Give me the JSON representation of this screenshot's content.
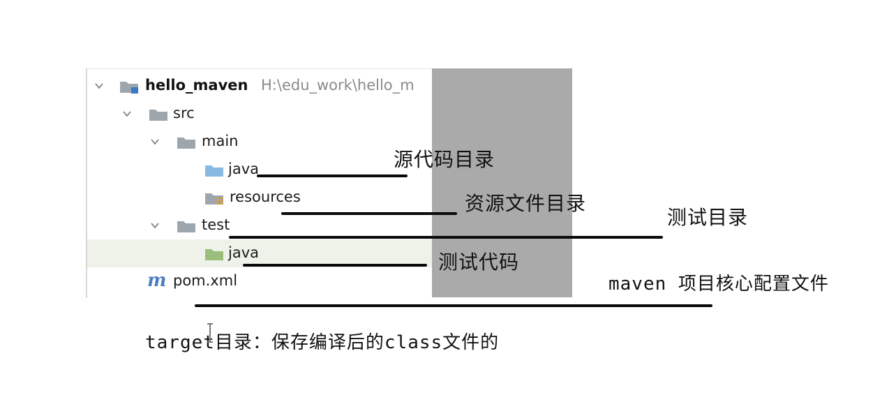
{
  "tree": {
    "root_name": "hello_maven",
    "root_path": "H:\\edu_work\\hello_m",
    "src": "src",
    "main": "main",
    "main_java": "java",
    "resources": "resources",
    "test": "test",
    "test_java": "java",
    "pom": "pom.xml"
  },
  "annotations": {
    "source_dir": "源代码目录",
    "resource_dir": "资源文件目录",
    "test_dir": "测试目录",
    "test_code": "测试代码",
    "pom_desc": "maven 项目核心配置文件",
    "target_desc": "target目录：保存编译后的class文件的"
  },
  "colors": {
    "folder_gray": "#9ea6ad",
    "folder_blue": "#87b9e3",
    "folder_green": "#9bbf7a",
    "maven_blue": "#4a7fc1",
    "overlay_gray": "#aaaaaa",
    "selection": "#eef2e8"
  },
  "icons": {
    "expand": "chevron-down-icon",
    "folder": "folder-icon",
    "maven": "maven-m-icon"
  }
}
